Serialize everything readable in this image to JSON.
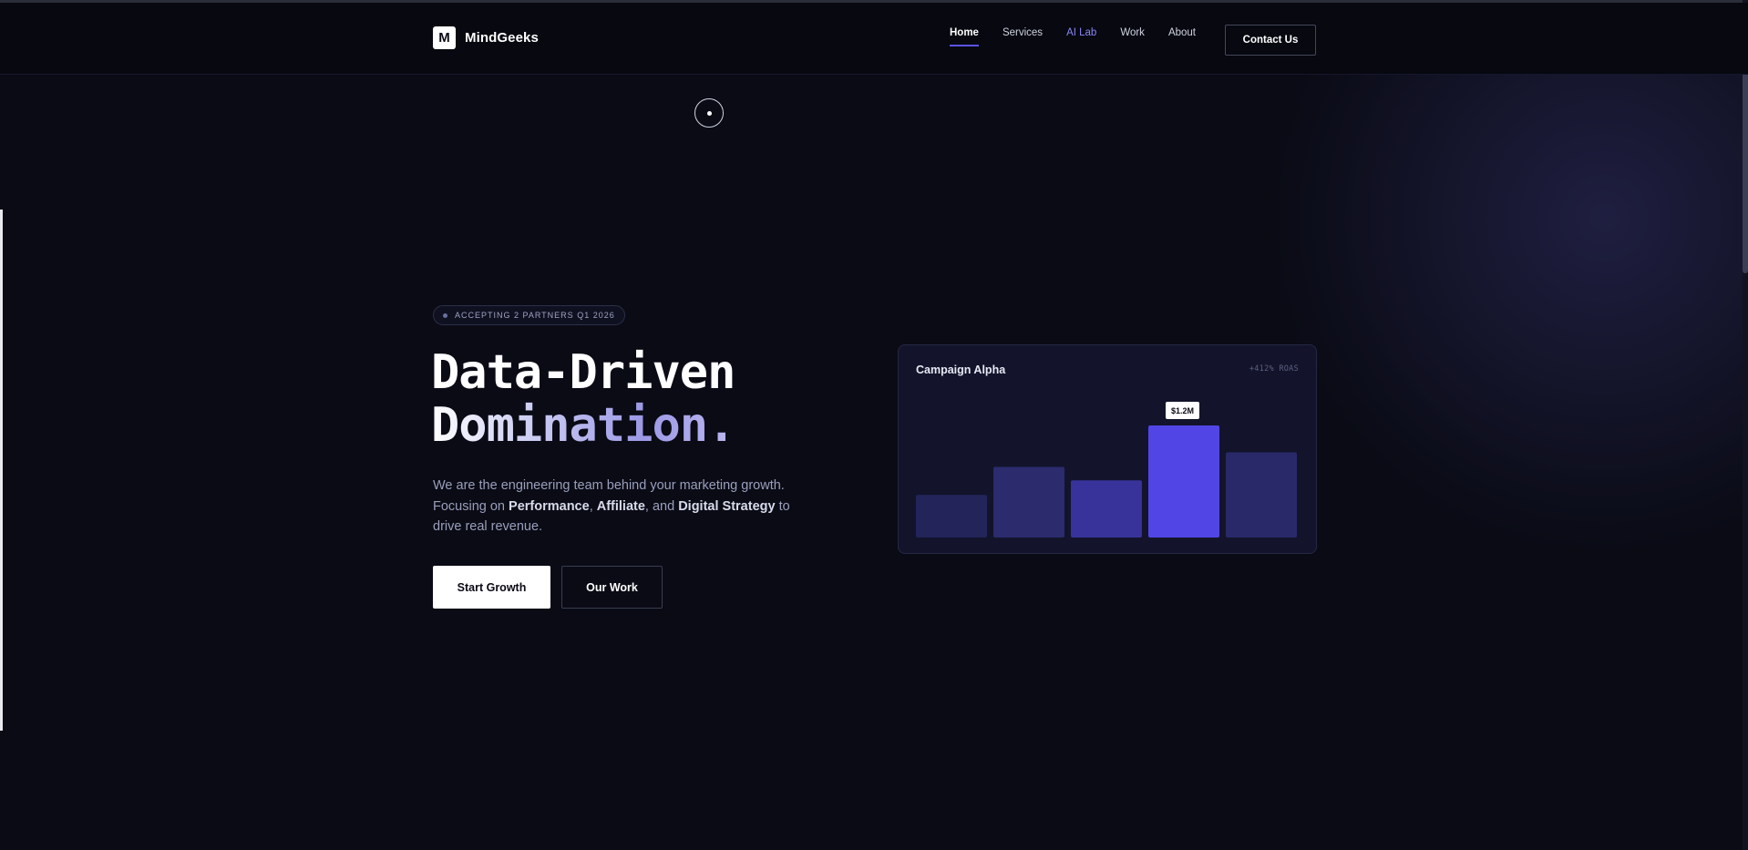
{
  "brand": {
    "logo_letter": "M",
    "name": "MindGeeks"
  },
  "nav": {
    "items": [
      {
        "label": "Home",
        "state": "active"
      },
      {
        "label": "Services",
        "state": "default"
      },
      {
        "label": "AI Lab",
        "state": "accent"
      },
      {
        "label": "Work",
        "state": "default"
      },
      {
        "label": "About",
        "state": "default"
      }
    ],
    "contact_label": "Contact Us"
  },
  "hero": {
    "badge": "ACCEPTING 2 PARTNERS Q1 2026",
    "headline_line1": "Data-Driven",
    "headline_line2": "Domination.",
    "subtext_intro": "We are the engineering team behind your marketing growth. Focusing on ",
    "subtext_bold1": "Performance",
    "subtext_sep1": ", ",
    "subtext_bold2": "Affiliate",
    "subtext_sep2": ", and ",
    "subtext_bold3": "Digital Strategy",
    "subtext_outro": " to drive real revenue.",
    "primary_cta": "Start Growth",
    "secondary_cta": "Our Work"
  },
  "card": {
    "title": "Campaign Alpha",
    "metric": "+412% ROAS"
  },
  "chart_data": {
    "type": "bar",
    "categories": [
      "",
      "",
      "",
      "",
      ""
    ],
    "values": [
      38,
      63,
      51,
      100,
      76
    ],
    "highlight_index": 3,
    "highlight_label": "$1.2M",
    "colors": [
      "#23245a",
      "#2b2b6e",
      "#37339a",
      "#5145e6",
      "#29296a"
    ],
    "ylim": [
      0,
      100
    ]
  },
  "colors": {
    "accent": "#5b52ef",
    "accent_light": "#8a84f5",
    "background": "#0a0b15"
  }
}
